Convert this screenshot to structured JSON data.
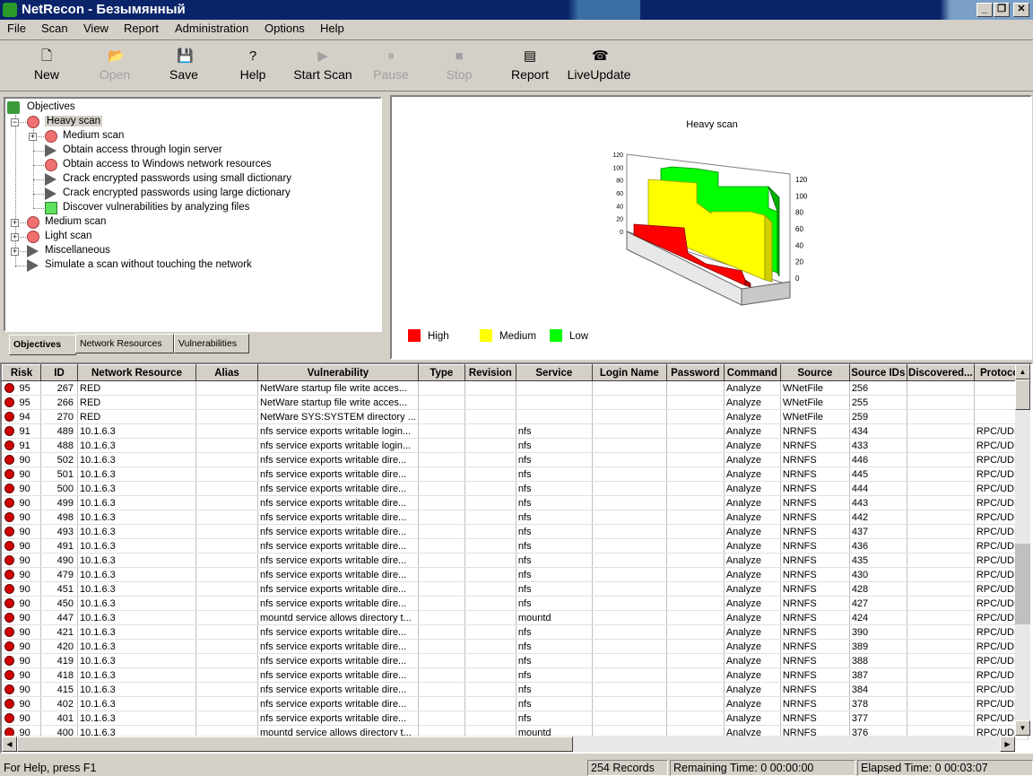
{
  "window": {
    "title": "NetRecon - Безымянный"
  },
  "menu": [
    "File",
    "Scan",
    "View",
    "Report",
    "Administration",
    "Options",
    "Help"
  ],
  "toolbar": {
    "new": "New",
    "open": "Open",
    "save": "Save",
    "help": "Help",
    "start_scan": "Start Scan",
    "pause": "Pause",
    "stop": "Stop",
    "report": "Report",
    "liveupdate": "LiveUpdate"
  },
  "tree": {
    "root": "Objectives",
    "items": [
      {
        "label": "Heavy scan"
      },
      {
        "label": "Medium scan"
      },
      {
        "label": "Obtain access through login server"
      },
      {
        "label": "Obtain access to Windows network resources"
      },
      {
        "label": "Crack encrypted passwords using small dictionary"
      },
      {
        "label": "Crack encrypted passwords using large dictionary"
      },
      {
        "label": "Discover vulnerabilities by analyzing files"
      },
      {
        "label": "Medium scan"
      },
      {
        "label": "Light scan"
      },
      {
        "label": "Miscellaneous"
      },
      {
        "label": "Simulate a scan without touching the network"
      }
    ]
  },
  "tabs": [
    "Objectives",
    "Network Resources",
    "Vulnerabilities"
  ],
  "chart_data": {
    "type": "area",
    "title": "Heavy scan",
    "y_ticks": [
      "0",
      "20",
      "40",
      "60",
      "80",
      "100",
      "120"
    ],
    "ylim": [
      0,
      120
    ],
    "series": [
      {
        "name": "High",
        "color": "#ff0000"
      },
      {
        "name": "Medium",
        "color": "#ffff00"
      },
      {
        "name": "Low",
        "color": "#00ff00"
      }
    ]
  },
  "grid": {
    "columns": [
      "Risk",
      "ID",
      "Network Resource",
      "Alias",
      "Vulnerability",
      "Type",
      "Revision",
      "Service",
      "Login Name",
      "Password",
      "Command",
      "Source",
      "Source IDs",
      "Discovered...",
      "Protocol"
    ],
    "rows": [
      [
        "95",
        "267",
        "RED",
        "",
        "NetWare startup file write acces...",
        "",
        "",
        "",
        "",
        "",
        "Analyze",
        "WNetFile",
        "256",
        "",
        ""
      ],
      [
        "95",
        "266",
        "RED",
        "",
        "NetWare startup file write acces...",
        "",
        "",
        "",
        "",
        "",
        "Analyze",
        "WNetFile",
        "255",
        "",
        ""
      ],
      [
        "94",
        "270",
        "RED",
        "",
        "NetWare SYS:SYSTEM directory ...",
        "",
        "",
        "",
        "",
        "",
        "Analyze",
        "WNetFile",
        "259",
        "",
        ""
      ],
      [
        "91",
        "489",
        "10.1.6.3",
        "",
        "nfs service exports writable login...",
        "",
        "",
        "nfs",
        "",
        "",
        "Analyze",
        "NRNFS",
        "434",
        "",
        "RPC/UDP"
      ],
      [
        "91",
        "488",
        "10.1.6.3",
        "",
        "nfs service exports writable login...",
        "",
        "",
        "nfs",
        "",
        "",
        "Analyze",
        "NRNFS",
        "433",
        "",
        "RPC/UDP"
      ],
      [
        "90",
        "502",
        "10.1.6.3",
        "",
        "nfs service exports writable dire...",
        "",
        "",
        "nfs",
        "",
        "",
        "Analyze",
        "NRNFS",
        "446",
        "",
        "RPC/UDP"
      ],
      [
        "90",
        "501",
        "10.1.6.3",
        "",
        "nfs service exports writable dire...",
        "",
        "",
        "nfs",
        "",
        "",
        "Analyze",
        "NRNFS",
        "445",
        "",
        "RPC/UDP"
      ],
      [
        "90",
        "500",
        "10.1.6.3",
        "",
        "nfs service exports writable dire...",
        "",
        "",
        "nfs",
        "",
        "",
        "Analyze",
        "NRNFS",
        "444",
        "",
        "RPC/UDP"
      ],
      [
        "90",
        "499",
        "10.1.6.3",
        "",
        "nfs service exports writable dire...",
        "",
        "",
        "nfs",
        "",
        "",
        "Analyze",
        "NRNFS",
        "443",
        "",
        "RPC/UDP"
      ],
      [
        "90",
        "498",
        "10.1.6.3",
        "",
        "nfs service exports writable dire...",
        "",
        "",
        "nfs",
        "",
        "",
        "Analyze",
        "NRNFS",
        "442",
        "",
        "RPC/UDP"
      ],
      [
        "90",
        "493",
        "10.1.6.3",
        "",
        "nfs service exports writable dire...",
        "",
        "",
        "nfs",
        "",
        "",
        "Analyze",
        "NRNFS",
        "437",
        "",
        "RPC/UDP"
      ],
      [
        "90",
        "491",
        "10.1.6.3",
        "",
        "nfs service exports writable dire...",
        "",
        "",
        "nfs",
        "",
        "",
        "Analyze",
        "NRNFS",
        "436",
        "",
        "RPC/UDP"
      ],
      [
        "90",
        "490",
        "10.1.6.3",
        "",
        "nfs service exports writable dire...",
        "",
        "",
        "nfs",
        "",
        "",
        "Analyze",
        "NRNFS",
        "435",
        "",
        "RPC/UDP"
      ],
      [
        "90",
        "479",
        "10.1.6.3",
        "",
        "nfs service exports writable dire...",
        "",
        "",
        "nfs",
        "",
        "",
        "Analyze",
        "NRNFS",
        "430",
        "",
        "RPC/UDP"
      ],
      [
        "90",
        "451",
        "10.1.6.3",
        "",
        "nfs service exports writable dire...",
        "",
        "",
        "nfs",
        "",
        "",
        "Analyze",
        "NRNFS",
        "428",
        "",
        "RPC/UDP"
      ],
      [
        "90",
        "450",
        "10.1.6.3",
        "",
        "nfs service exports writable dire...",
        "",
        "",
        "nfs",
        "",
        "",
        "Analyze",
        "NRNFS",
        "427",
        "",
        "RPC/UDP"
      ],
      [
        "90",
        "447",
        "10.1.6.3",
        "",
        "mountd service allows directory t...",
        "",
        "",
        "mountd",
        "",
        "",
        "Analyze",
        "NRNFS",
        "424",
        "",
        "RPC/UDP"
      ],
      [
        "90",
        "421",
        "10.1.6.3",
        "",
        "nfs service exports writable dire...",
        "",
        "",
        "nfs",
        "",
        "",
        "Analyze",
        "NRNFS",
        "390",
        "",
        "RPC/UDP"
      ],
      [
        "90",
        "420",
        "10.1.6.3",
        "",
        "nfs service exports writable dire...",
        "",
        "",
        "nfs",
        "",
        "",
        "Analyze",
        "NRNFS",
        "389",
        "",
        "RPC/UDP"
      ],
      [
        "90",
        "419",
        "10.1.6.3",
        "",
        "nfs service exports writable dire...",
        "",
        "",
        "nfs",
        "",
        "",
        "Analyze",
        "NRNFS",
        "388",
        "",
        "RPC/UDP"
      ],
      [
        "90",
        "418",
        "10.1.6.3",
        "",
        "nfs service exports writable dire...",
        "",
        "",
        "nfs",
        "",
        "",
        "Analyze",
        "NRNFS",
        "387",
        "",
        "RPC/UDP"
      ],
      [
        "90",
        "415",
        "10.1.6.3",
        "",
        "nfs service exports writable dire...",
        "",
        "",
        "nfs",
        "",
        "",
        "Analyze",
        "NRNFS",
        "384",
        "",
        "RPC/UDP"
      ],
      [
        "90",
        "402",
        "10.1.6.3",
        "",
        "nfs service exports writable dire...",
        "",
        "",
        "nfs",
        "",
        "",
        "Analyze",
        "NRNFS",
        "378",
        "",
        "RPC/UDP"
      ],
      [
        "90",
        "401",
        "10.1.6.3",
        "",
        "nfs service exports writable dire...",
        "",
        "",
        "nfs",
        "",
        "",
        "Analyze",
        "NRNFS",
        "377",
        "",
        "RPC/UDP"
      ],
      [
        "90",
        "400",
        "10.1.6.3",
        "",
        "mountd service allows directory t...",
        "",
        "",
        "mountd",
        "",
        "",
        "Analyze",
        "NRNFS",
        "376",
        "",
        "RPC/UDP"
      ]
    ]
  },
  "status": {
    "help": "For Help, press F1",
    "records": "254 Records",
    "remaining": "Remaining Time: 0 00:00:00",
    "elapsed": "Elapsed Time: 0 00:03:07"
  }
}
